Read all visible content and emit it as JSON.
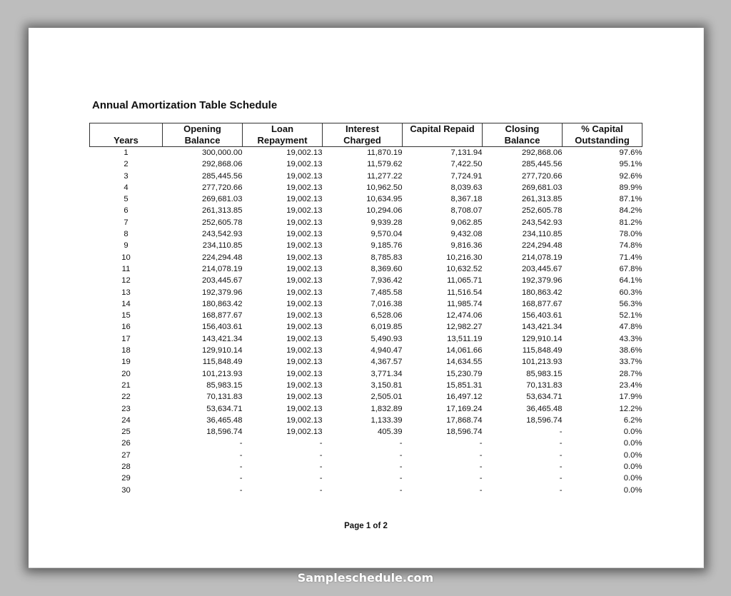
{
  "document": {
    "title": "Annual Amortization Table Schedule",
    "page_label": "Page 1 of 2",
    "watermark": "Sampleschedule.com"
  },
  "table": {
    "headers": [
      {
        "line1": "",
        "line2": "Years"
      },
      {
        "line1": "Opening",
        "line2": "Balance"
      },
      {
        "line1": "Loan",
        "line2": "Repayment"
      },
      {
        "line1": "Interest",
        "line2": "Charged"
      },
      {
        "line1": "Capital Repaid",
        "line2": ""
      },
      {
        "line1": "Closing",
        "line2": "Balance"
      },
      {
        "line1": "% Capital",
        "line2": "Outstanding"
      }
    ],
    "rows": [
      [
        "1",
        "300,000.00",
        "19,002.13",
        "11,870.19",
        "7,131.94",
        "292,868.06",
        "97.6%"
      ],
      [
        "2",
        "292,868.06",
        "19,002.13",
        "11,579.62",
        "7,422.50",
        "285,445.56",
        "95.1%"
      ],
      [
        "3",
        "285,445.56",
        "19,002.13",
        "11,277.22",
        "7,724.91",
        "277,720.66",
        "92.6%"
      ],
      [
        "4",
        "277,720.66",
        "19,002.13",
        "10,962.50",
        "8,039.63",
        "269,681.03",
        "89.9%"
      ],
      [
        "5",
        "269,681.03",
        "19,002.13",
        "10,634.95",
        "8,367.18",
        "261,313.85",
        "87.1%"
      ],
      [
        "6",
        "261,313.85",
        "19,002.13",
        "10,294.06",
        "8,708.07",
        "252,605.78",
        "84.2%"
      ],
      [
        "7",
        "252,605.78",
        "19,002.13",
        "9,939.28",
        "9,062.85",
        "243,542.93",
        "81.2%"
      ],
      [
        "8",
        "243,542.93",
        "19,002.13",
        "9,570.04",
        "9,432.08",
        "234,110.85",
        "78.0%"
      ],
      [
        "9",
        "234,110.85",
        "19,002.13",
        "9,185.76",
        "9,816.36",
        "224,294.48",
        "74.8%"
      ],
      [
        "10",
        "224,294.48",
        "19,002.13",
        "8,785.83",
        "10,216.30",
        "214,078.19",
        "71.4%"
      ],
      [
        "11",
        "214,078.19",
        "19,002.13",
        "8,369.60",
        "10,632.52",
        "203,445.67",
        "67.8%"
      ],
      [
        "12",
        "203,445.67",
        "19,002.13",
        "7,936.42",
        "11,065.71",
        "192,379.96",
        "64.1%"
      ],
      [
        "13",
        "192,379.96",
        "19,002.13",
        "7,485.58",
        "11,516.54",
        "180,863.42",
        "60.3%"
      ],
      [
        "14",
        "180,863.42",
        "19,002.13",
        "7,016.38",
        "11,985.74",
        "168,877.67",
        "56.3%"
      ],
      [
        "15",
        "168,877.67",
        "19,002.13",
        "6,528.06",
        "12,474.06",
        "156,403.61",
        "52.1%"
      ],
      [
        "16",
        "156,403.61",
        "19,002.13",
        "6,019.85",
        "12,982.27",
        "143,421.34",
        "47.8%"
      ],
      [
        "17",
        "143,421.34",
        "19,002.13",
        "5,490.93",
        "13,511.19",
        "129,910.14",
        "43.3%"
      ],
      [
        "18",
        "129,910.14",
        "19,002.13",
        "4,940.47",
        "14,061.66",
        "115,848.49",
        "38.6%"
      ],
      [
        "19",
        "115,848.49",
        "19,002.13",
        "4,367.57",
        "14,634.55",
        "101,213.93",
        "33.7%"
      ],
      [
        "20",
        "101,213.93",
        "19,002.13",
        "3,771.34",
        "15,230.79",
        "85,983.15",
        "28.7%"
      ],
      [
        "21",
        "85,983.15",
        "19,002.13",
        "3,150.81",
        "15,851.31",
        "70,131.83",
        "23.4%"
      ],
      [
        "22",
        "70,131.83",
        "19,002.13",
        "2,505.01",
        "16,497.12",
        "53,634.71",
        "17.9%"
      ],
      [
        "23",
        "53,634.71",
        "19,002.13",
        "1,832.89",
        "17,169.24",
        "36,465.48",
        "12.2%"
      ],
      [
        "24",
        "36,465.48",
        "19,002.13",
        "1,133.39",
        "17,868.74",
        "18,596.74",
        "6.2%"
      ],
      [
        "25",
        "18,596.74",
        "19,002.13",
        "405.39",
        "18,596.74",
        "-",
        "0.0%"
      ],
      [
        "26",
        "-",
        "-",
        "-",
        "-",
        "-",
        "0.0%"
      ],
      [
        "27",
        "-",
        "-",
        "-",
        "-",
        "-",
        "0.0%"
      ],
      [
        "28",
        "-",
        "-",
        "-",
        "-",
        "-",
        "0.0%"
      ],
      [
        "29",
        "-",
        "-",
        "-",
        "-",
        "-",
        "0.0%"
      ],
      [
        "30",
        "-",
        "-",
        "-",
        "-",
        "-",
        "0.0%"
      ]
    ]
  }
}
